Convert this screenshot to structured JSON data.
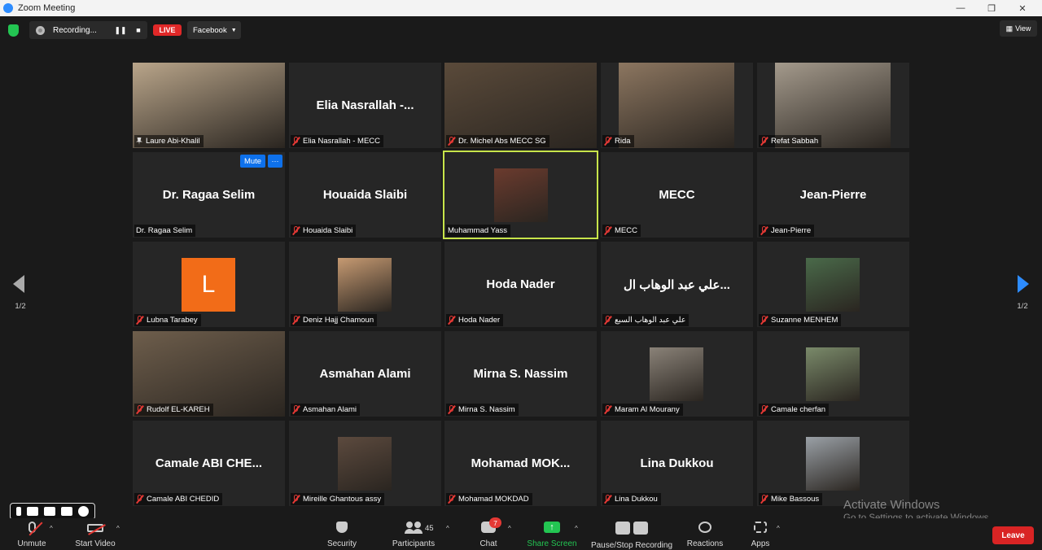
{
  "window": {
    "title": "Zoom Meeting",
    "minimize": "—",
    "restore": "❐",
    "close": "✕"
  },
  "topbar": {
    "recording_label": "Recording...",
    "live_label": "LIVE",
    "stream_target": "Facebook",
    "view_label": "View"
  },
  "pagination": {
    "left": "1/2",
    "right": "1/2"
  },
  "participants": [
    {
      "tile_name": "",
      "label": "Laure Abi-Khalil",
      "pinned": true
    },
    {
      "tile_name": "Elia  Nasrallah  -...",
      "label": "Elia Nasrallah - MECC",
      "muted": true
    },
    {
      "tile_name": "",
      "label": "Dr. Michel Abs MECC SG",
      "muted": true
    },
    {
      "tile_name": "",
      "label": "Rida",
      "muted": true
    },
    {
      "tile_name": "",
      "label": "Refat Sabbah",
      "muted": true
    },
    {
      "tile_name": "Dr. Ragaa Selim",
      "label": "Dr. Ragaa Selim"
    },
    {
      "tile_name": "Houaida Slaibi",
      "label": "Houaida Slaibi",
      "muted": true
    },
    {
      "tile_name": "",
      "label": "Muhammad Yass",
      "active": true
    },
    {
      "tile_name": "MECC",
      "label": "MECC",
      "muted": true
    },
    {
      "tile_name": "Jean-Pierre",
      "label": "Jean-Pierre",
      "muted": true
    },
    {
      "tile_name": "",
      "label": "Lubna Tarabey",
      "avatar_letter": "L",
      "muted": true
    },
    {
      "tile_name": "",
      "label": "Deniz Hajj Chamoun",
      "muted": true
    },
    {
      "tile_name": "Hoda Nader",
      "label": "Hoda Nader",
      "muted": true
    },
    {
      "tile_name": "علي عبد الوهاب ال...",
      "label": "علي عبد الوهاب السبع",
      "muted": true
    },
    {
      "tile_name": "",
      "label": "Suzanne MENHEM",
      "muted": true
    },
    {
      "tile_name": "",
      "label": "Rudolf EL-KAREH",
      "muted": true
    },
    {
      "tile_name": "Asmahan Alami",
      "label": "Asmahan Alami",
      "muted": true
    },
    {
      "tile_name": "Mirna  S. Nassim",
      "label": "Mirna  S. Nassim",
      "muted": true
    },
    {
      "tile_name": "",
      "label": "Maram Al Mourany",
      "muted": true
    },
    {
      "tile_name": "",
      "label": "Camale cherfan",
      "muted": true
    },
    {
      "tile_name": "Camale  ABI  CHE...",
      "label": "Camale ABI CHEDID",
      "muted": true
    },
    {
      "tile_name": "",
      "label": "Mireille Ghantous assy",
      "muted": true
    },
    {
      "tile_name": "Mohamad  MOK...",
      "label": "Mohamad MOKDAD",
      "muted": true
    },
    {
      "tile_name": "Lina Dukkou",
      "label": "Lina Dukkou",
      "muted": true
    },
    {
      "tile_name": "",
      "label": "Mike Bassous",
      "muted": true
    }
  ],
  "hover_controls": {
    "mute": "Mute",
    "more": "···"
  },
  "toolbar": {
    "unmute": "Unmute",
    "start_video": "Start Video",
    "security": "Security",
    "participants": "Participants",
    "participants_count": "45",
    "chat": "Chat",
    "chat_badge": "7",
    "share_screen": "Share Screen",
    "pause_stop_recording": "Pause/Stop Recording",
    "reactions": "Reactions",
    "apps": "Apps",
    "leave": "Leave",
    "caret": "^"
  },
  "watermark": {
    "line1": "Activate Windows",
    "line2": "Go to Settings to activate Windows."
  },
  "colors": {
    "accent_blue": "#0e71eb",
    "active_speaker": "#c7e44a",
    "live_red": "#e02828",
    "leave_red": "#d92424",
    "share_green": "#23c552"
  }
}
